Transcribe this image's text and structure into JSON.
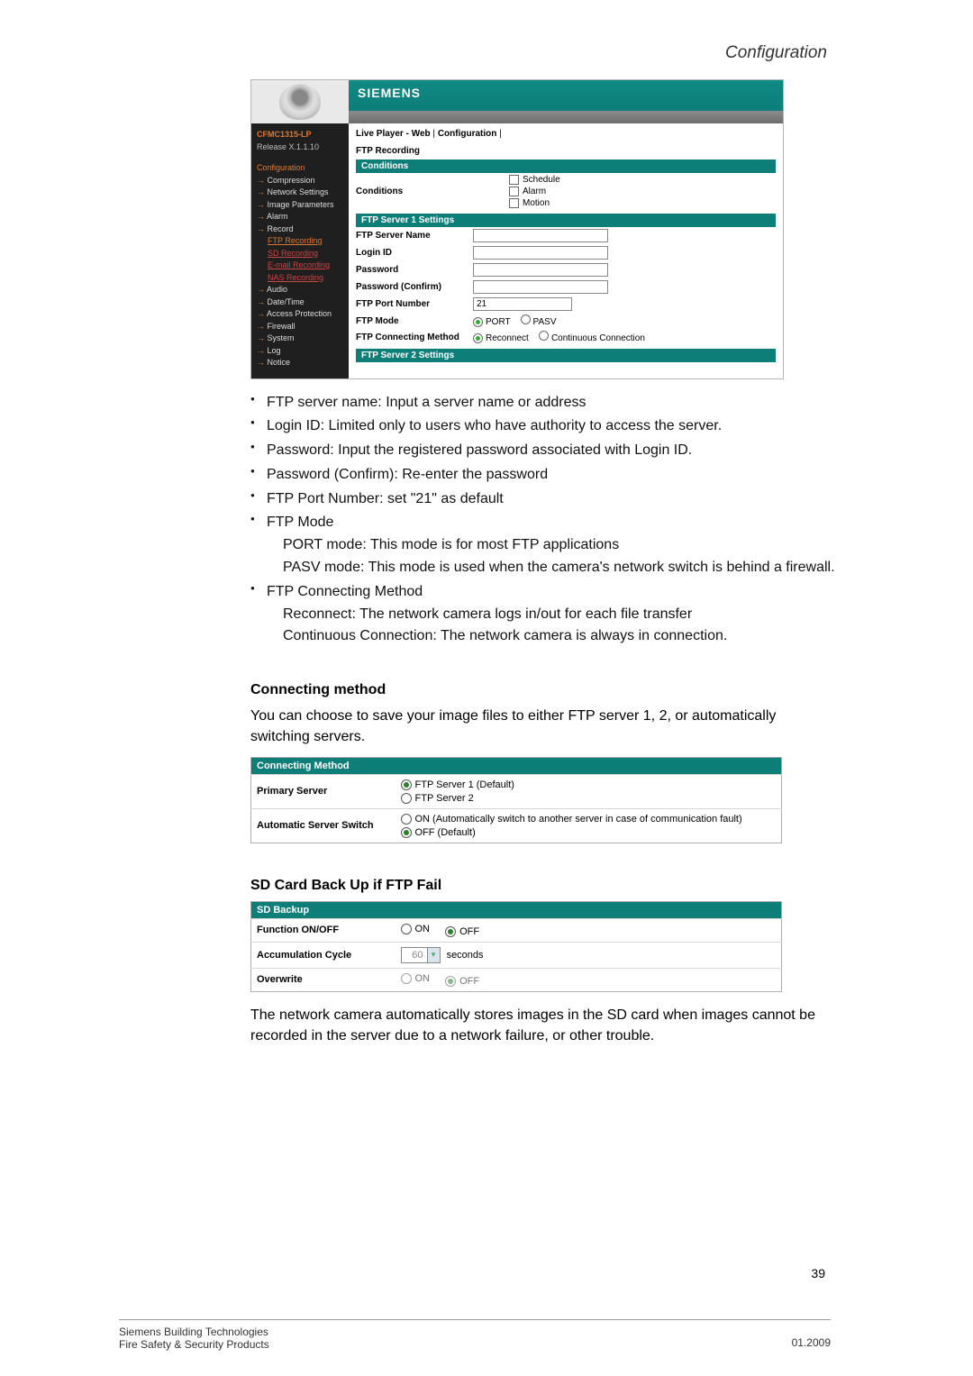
{
  "header": {
    "title": "Configuration"
  },
  "shot": {
    "brand": "SIEMENS",
    "model": "CFMC1315-LP",
    "release": "Release X.1.1.10",
    "breadcrumb_a": "Live Player - Web",
    "breadcrumb_b": "Configuration",
    "section_title": "FTP Recording",
    "nav": {
      "cfg": "Configuration",
      "items": [
        "Compression",
        "Network Settings",
        "Image Parameters",
        "Alarm",
        "Record"
      ],
      "subs": [
        "FTP Recording",
        "SD Recording",
        "E-mail Recording",
        "NAS Recording"
      ],
      "tail": [
        "Audio",
        "Date/Time",
        "Access Protection",
        "Firewall",
        "System",
        "Log",
        "Notice"
      ]
    },
    "conditions_hdr": "Conditions",
    "conditions_lbl": "Conditions",
    "cond": {
      "schedule": "Schedule",
      "alarm": "Alarm",
      "motion": "Motion"
    },
    "srv1_hdr": "FTP Server 1 Settings",
    "rows": {
      "name": "FTP Server Name",
      "login": "Login ID",
      "pass": "Password",
      "passc": "Password (Confirm)",
      "port": "FTP Port Number",
      "port_val": "21",
      "mode": "FTP Mode",
      "mode_port": "PORT",
      "mode_pasv": "PASV",
      "conn": "FTP Connecting Method",
      "conn_re": "Reconnect",
      "conn_cc": "Continuous Connection"
    },
    "srv2_hdr": "FTP Server 2 Settings"
  },
  "bullets": {
    "b1": "FTP server name: Input a server name or address",
    "b2": "Login ID: Limited only to users who have authority to access the server.",
    "b3": "Password: Input the registered password associated with Login ID.",
    "b4": "Password (Confirm): Re-enter the password",
    "b5": "FTP Port Number: set \"21\" as default",
    "b6": "FTP Mode",
    "b6a": "PORT mode: This mode is for most FTP applications",
    "b6b": "PASV mode: This mode is used when the camera's network switch is behind a firewall.",
    "b7": "FTP Connecting Method",
    "b7a": "Reconnect: The network camera logs in/out for each file transfer",
    "b7b": "Continuous Connection: The network camera is always in connection."
  },
  "connmethod": {
    "head": "Connecting method",
    "para": "You can choose to save your image files to either FTP server 1, 2, or automatically switching servers.",
    "tbl_hdr": "Connecting Method",
    "primary_lbl": "Primary Server",
    "primary_opt1": "FTP Server 1 (Default)",
    "primary_opt2": "FTP Server 2",
    "auto_lbl": "Automatic Server Switch",
    "auto_opt1": "ON (Automatically switch to another server in case of communication fault)",
    "auto_opt2": "OFF (Default)"
  },
  "sdbackup": {
    "head": "SD Card Back Up if FTP Fail",
    "tbl_hdr": "SD Backup",
    "func_lbl": "Function ON/OFF",
    "on": "ON",
    "off": "OFF",
    "acc_lbl": "Accumulation Cycle",
    "acc_val": "60",
    "acc_unit": "seconds",
    "ow_lbl": "Overwrite",
    "para": "The network camera automatically stores images in the SD card when images cannot be recorded in the server due to a network failure, or other trouble."
  },
  "footer": {
    "pagenum": "39",
    "l1": "Siemens Building Technologies",
    "l2": "Fire Safety & Security Products",
    "date": "01.2009"
  }
}
